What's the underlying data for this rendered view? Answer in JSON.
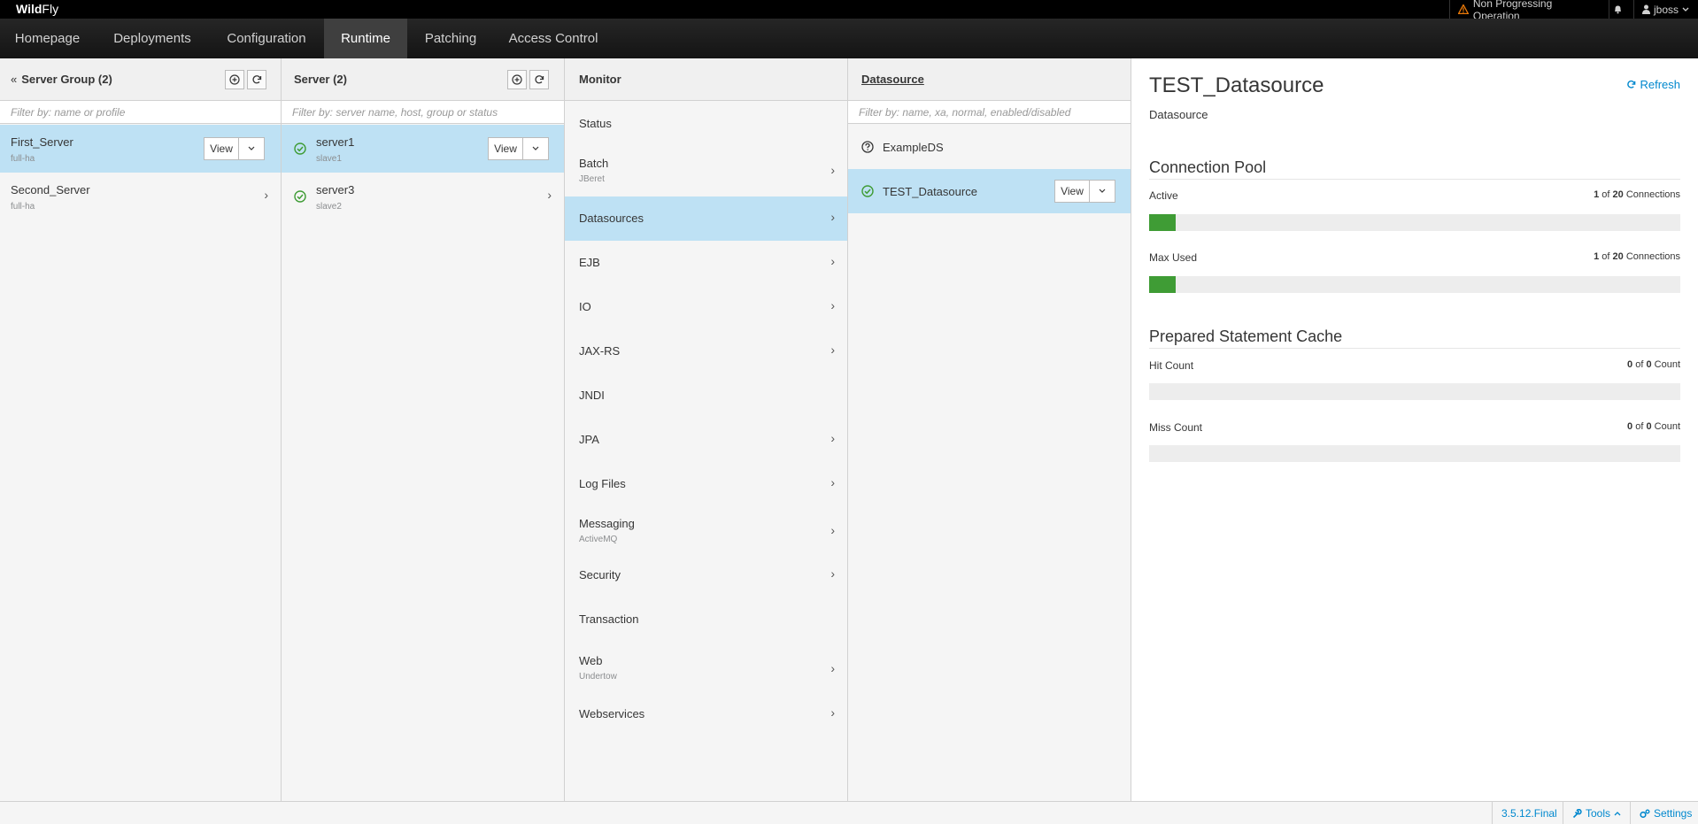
{
  "brand": {
    "bold": "Wild",
    "rest": "Fly"
  },
  "topbar": {
    "warning": "Non Progressing Operation",
    "user": "jboss"
  },
  "nav": {
    "items": [
      "Homepage",
      "Deployments",
      "Configuration",
      "Runtime",
      "Patching",
      "Access Control"
    ],
    "active": "Runtime"
  },
  "server_groups": {
    "back": "«",
    "title": "Server Group (2)",
    "filter": "Filter by: name or profile",
    "items": [
      {
        "name": "First_Server",
        "profile": "full-ha"
      },
      {
        "name": "Second_Server",
        "profile": "full-ha"
      }
    ]
  },
  "servers": {
    "title": "Server (2)",
    "filter": "Filter by: server name, host, group or status",
    "items": [
      {
        "name": "server1",
        "host": "slave1"
      },
      {
        "name": "server3",
        "host": "slave2"
      }
    ]
  },
  "view_label": "View",
  "monitor": {
    "title": "Monitor",
    "items": [
      {
        "label": "Status",
        "sub": ""
      },
      {
        "label": "Batch",
        "sub": "JBeret"
      },
      {
        "label": "Datasources",
        "sub": ""
      },
      {
        "label": "EJB",
        "sub": ""
      },
      {
        "label": "IO",
        "sub": ""
      },
      {
        "label": "JAX-RS",
        "sub": ""
      },
      {
        "label": "JNDI",
        "sub": ""
      },
      {
        "label": "JPA",
        "sub": ""
      },
      {
        "label": "Log Files",
        "sub": ""
      },
      {
        "label": "Messaging",
        "sub": "ActiveMQ"
      },
      {
        "label": "Security",
        "sub": ""
      },
      {
        "label": "Transaction",
        "sub": ""
      },
      {
        "label": "Web",
        "sub": "Undertow"
      },
      {
        "label": "Webservices",
        "sub": ""
      }
    ]
  },
  "datasource": {
    "title": "Datasource",
    "filter": "Filter by: name, xa, normal, enabled/disabled",
    "items": [
      {
        "name": "ExampleDS",
        "status": "unknown"
      },
      {
        "name": "TEST_Datasource",
        "status": "ok"
      }
    ]
  },
  "detail": {
    "title": "TEST_Datasource",
    "subtitle": "Datasource",
    "refresh": "Refresh",
    "sections": [
      {
        "title": "Connection Pool",
        "metrics": [
          {
            "label": "Active",
            "current": "1",
            "of": "of",
            "total": "20",
            "unit": "Connections",
            "fraction": 0.05
          },
          {
            "label": "Max Used",
            "current": "1",
            "of": "of",
            "total": "20",
            "unit": "Connections",
            "fraction": 0.05
          }
        ]
      },
      {
        "title": "Prepared Statement Cache",
        "metrics": [
          {
            "label": "Hit Count",
            "current": "0",
            "of": "of",
            "total": "0",
            "unit": "Count",
            "fraction": 0
          },
          {
            "label": "Miss Count",
            "current": "0",
            "of": "of",
            "total": "0",
            "unit": "Count",
            "fraction": 0
          }
        ]
      }
    ]
  },
  "footer": {
    "version": "3.5.12.Final",
    "tools": "Tools",
    "settings": "Settings"
  },
  "colors": {
    "selected": "#bee1f4",
    "progress": "#3f9c35",
    "link": "#0088ce",
    "ok": "#3f9c35",
    "warning": "#ec7a08"
  }
}
